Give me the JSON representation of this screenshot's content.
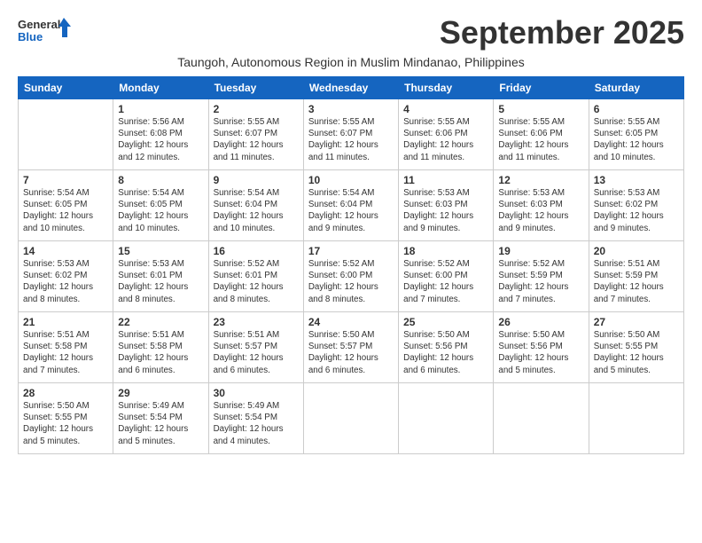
{
  "logo": {
    "line1": "General",
    "line2": "Blue"
  },
  "title": "September 2025",
  "subtitle": "Taungoh, Autonomous Region in Muslim Mindanao, Philippines",
  "days_of_week": [
    "Sunday",
    "Monday",
    "Tuesday",
    "Wednesday",
    "Thursday",
    "Friday",
    "Saturday"
  ],
  "weeks": [
    [
      {
        "day": "",
        "info": ""
      },
      {
        "day": "1",
        "info": "Sunrise: 5:56 AM\nSunset: 6:08 PM\nDaylight: 12 hours\nand 12 minutes."
      },
      {
        "day": "2",
        "info": "Sunrise: 5:55 AM\nSunset: 6:07 PM\nDaylight: 12 hours\nand 11 minutes."
      },
      {
        "day": "3",
        "info": "Sunrise: 5:55 AM\nSunset: 6:07 PM\nDaylight: 12 hours\nand 11 minutes."
      },
      {
        "day": "4",
        "info": "Sunrise: 5:55 AM\nSunset: 6:06 PM\nDaylight: 12 hours\nand 11 minutes."
      },
      {
        "day": "5",
        "info": "Sunrise: 5:55 AM\nSunset: 6:06 PM\nDaylight: 12 hours\nand 11 minutes."
      },
      {
        "day": "6",
        "info": "Sunrise: 5:55 AM\nSunset: 6:05 PM\nDaylight: 12 hours\nand 10 minutes."
      }
    ],
    [
      {
        "day": "7",
        "info": "Sunrise: 5:54 AM\nSunset: 6:05 PM\nDaylight: 12 hours\nand 10 minutes."
      },
      {
        "day": "8",
        "info": "Sunrise: 5:54 AM\nSunset: 6:05 PM\nDaylight: 12 hours\nand 10 minutes."
      },
      {
        "day": "9",
        "info": "Sunrise: 5:54 AM\nSunset: 6:04 PM\nDaylight: 12 hours\nand 10 minutes."
      },
      {
        "day": "10",
        "info": "Sunrise: 5:54 AM\nSunset: 6:04 PM\nDaylight: 12 hours\nand 9 minutes."
      },
      {
        "day": "11",
        "info": "Sunrise: 5:53 AM\nSunset: 6:03 PM\nDaylight: 12 hours\nand 9 minutes."
      },
      {
        "day": "12",
        "info": "Sunrise: 5:53 AM\nSunset: 6:03 PM\nDaylight: 12 hours\nand 9 minutes."
      },
      {
        "day": "13",
        "info": "Sunrise: 5:53 AM\nSunset: 6:02 PM\nDaylight: 12 hours\nand 9 minutes."
      }
    ],
    [
      {
        "day": "14",
        "info": "Sunrise: 5:53 AM\nSunset: 6:02 PM\nDaylight: 12 hours\nand 8 minutes."
      },
      {
        "day": "15",
        "info": "Sunrise: 5:53 AM\nSunset: 6:01 PM\nDaylight: 12 hours\nand 8 minutes."
      },
      {
        "day": "16",
        "info": "Sunrise: 5:52 AM\nSunset: 6:01 PM\nDaylight: 12 hours\nand 8 minutes."
      },
      {
        "day": "17",
        "info": "Sunrise: 5:52 AM\nSunset: 6:00 PM\nDaylight: 12 hours\nand 8 minutes."
      },
      {
        "day": "18",
        "info": "Sunrise: 5:52 AM\nSunset: 6:00 PM\nDaylight: 12 hours\nand 7 minutes."
      },
      {
        "day": "19",
        "info": "Sunrise: 5:52 AM\nSunset: 5:59 PM\nDaylight: 12 hours\nand 7 minutes."
      },
      {
        "day": "20",
        "info": "Sunrise: 5:51 AM\nSunset: 5:59 PM\nDaylight: 12 hours\nand 7 minutes."
      }
    ],
    [
      {
        "day": "21",
        "info": "Sunrise: 5:51 AM\nSunset: 5:58 PM\nDaylight: 12 hours\nand 7 minutes."
      },
      {
        "day": "22",
        "info": "Sunrise: 5:51 AM\nSunset: 5:58 PM\nDaylight: 12 hours\nand 6 minutes."
      },
      {
        "day": "23",
        "info": "Sunrise: 5:51 AM\nSunset: 5:57 PM\nDaylight: 12 hours\nand 6 minutes."
      },
      {
        "day": "24",
        "info": "Sunrise: 5:50 AM\nSunset: 5:57 PM\nDaylight: 12 hours\nand 6 minutes."
      },
      {
        "day": "25",
        "info": "Sunrise: 5:50 AM\nSunset: 5:56 PM\nDaylight: 12 hours\nand 6 minutes."
      },
      {
        "day": "26",
        "info": "Sunrise: 5:50 AM\nSunset: 5:56 PM\nDaylight: 12 hours\nand 5 minutes."
      },
      {
        "day": "27",
        "info": "Sunrise: 5:50 AM\nSunset: 5:55 PM\nDaylight: 12 hours\nand 5 minutes."
      }
    ],
    [
      {
        "day": "28",
        "info": "Sunrise: 5:50 AM\nSunset: 5:55 PM\nDaylight: 12 hours\nand 5 minutes."
      },
      {
        "day": "29",
        "info": "Sunrise: 5:49 AM\nSunset: 5:54 PM\nDaylight: 12 hours\nand 5 minutes."
      },
      {
        "day": "30",
        "info": "Sunrise: 5:49 AM\nSunset: 5:54 PM\nDaylight: 12 hours\nand 4 minutes."
      },
      {
        "day": "",
        "info": ""
      },
      {
        "day": "",
        "info": ""
      },
      {
        "day": "",
        "info": ""
      },
      {
        "day": "",
        "info": ""
      }
    ]
  ]
}
